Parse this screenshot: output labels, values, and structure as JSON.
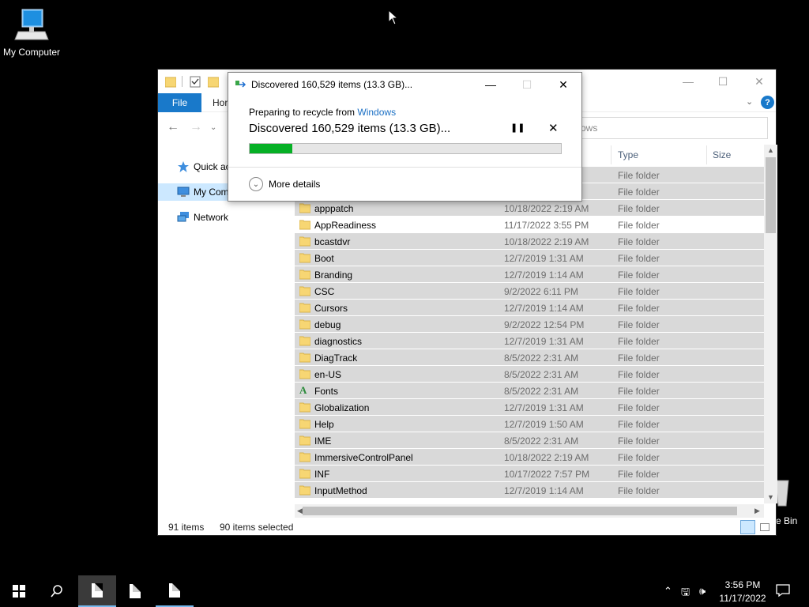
{
  "desktop": {
    "icons": [
      {
        "label": "My Computer"
      },
      {
        "label": "e Bin"
      }
    ]
  },
  "explorer": {
    "ribbon": {
      "file_tab": "File",
      "home_tab": "Hor"
    },
    "search_placeholder": "ows",
    "nav_pane": [
      {
        "label": "Quick ac"
      },
      {
        "label": "My Com"
      },
      {
        "label": "Network"
      }
    ],
    "columns": {
      "type": "Type",
      "size": "Size"
    },
    "rows": [
      {
        "name": "",
        "date": "",
        "type": "File folder",
        "selected": true
      },
      {
        "name": "",
        "date": "",
        "type": "File folder",
        "selected": true
      },
      {
        "name": "apppatch",
        "date": "10/18/2022 2:19 AM",
        "type": "File folder",
        "selected": true
      },
      {
        "name": "AppReadiness",
        "date": "11/17/2022 3:55 PM",
        "type": "File folder",
        "selected": false
      },
      {
        "name": "bcastdvr",
        "date": "10/18/2022 2:19 AM",
        "type": "File folder",
        "selected": true
      },
      {
        "name": "Boot",
        "date": "12/7/2019 1:31 AM",
        "type": "File folder",
        "selected": true
      },
      {
        "name": "Branding",
        "date": "12/7/2019 1:14 AM",
        "type": "File folder",
        "selected": true
      },
      {
        "name": "CSC",
        "date": "9/2/2022 6:11 PM",
        "type": "File folder",
        "selected": true
      },
      {
        "name": "Cursors",
        "date": "12/7/2019 1:14 AM",
        "type": "File folder",
        "selected": true
      },
      {
        "name": "debug",
        "date": "9/2/2022 12:54 PM",
        "type": "File folder",
        "selected": true
      },
      {
        "name": "diagnostics",
        "date": "12/7/2019 1:31 AM",
        "type": "File folder",
        "selected": true
      },
      {
        "name": "DiagTrack",
        "date": "8/5/2022 2:31 AM",
        "type": "File folder",
        "selected": true
      },
      {
        "name": "en-US",
        "date": "8/5/2022 2:31 AM",
        "type": "File folder",
        "selected": true
      },
      {
        "name": "Fonts",
        "date": "8/5/2022 2:31 AM",
        "type": "File folder",
        "selected": true,
        "icon": "fonts-icon"
      },
      {
        "name": "Globalization",
        "date": "12/7/2019 1:31 AM",
        "type": "File folder",
        "selected": true
      },
      {
        "name": "Help",
        "date": "12/7/2019 1:50 AM",
        "type": "File folder",
        "selected": true
      },
      {
        "name": "IME",
        "date": "8/5/2022 2:31 AM",
        "type": "File folder",
        "selected": true
      },
      {
        "name": "ImmersiveControlPanel",
        "date": "10/18/2022 2:19 AM",
        "type": "File folder",
        "selected": true
      },
      {
        "name": "INF",
        "date": "10/17/2022 7:57 PM",
        "type": "File folder",
        "selected": true
      },
      {
        "name": "InputMethod",
        "date": "12/7/2019 1:14 AM",
        "type": "File folder",
        "selected": true
      }
    ],
    "status": {
      "items": "91 items",
      "selected": "90 items selected"
    }
  },
  "dialog": {
    "title": "Discovered 160,529 items (13.3 GB)...",
    "preparing_prefix": "Preparing to recycle from ",
    "preparing_source": "Windows",
    "status": "Discovered 160,529 items (13.3 GB)...",
    "progress": 0.138,
    "more_details": "More details"
  },
  "taskbar": {
    "time": "3:56 PM",
    "date": "11/17/2022"
  },
  "colors": {
    "accent": "#1979ca",
    "progress_fill": "#06b025",
    "selection": "#d9d9d9"
  }
}
